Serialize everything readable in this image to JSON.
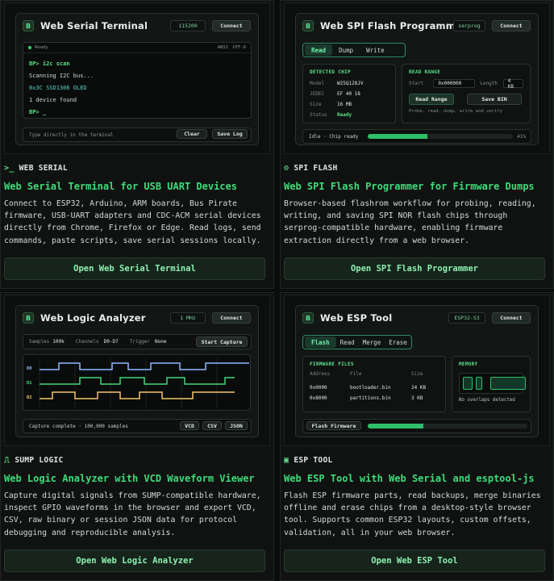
{
  "cards": [
    {
      "window_title": "Web Serial Terminal",
      "baud": "115200",
      "connect": "Connect",
      "status": "Ready",
      "encoding1": "ANSI",
      "encoding2": "UTF-8",
      "lines": [
        {
          "text": "BP> i2c scan",
          "color": "#5ee08a"
        },
        {
          "text": "Scanning I2C bus...",
          "color": "#d3dad6"
        },
        {
          "text": "0x3C SSD1306 OLED",
          "color": "#5fd0c8"
        },
        {
          "text": "1 device found",
          "color": "#d3dad6"
        },
        {
          "text": "BP> _",
          "color": "#5ee08a"
        }
      ],
      "input_placeholder": "Type directly in the terminal",
      "clear": "Clear",
      "save_log": "Save Log",
      "section": "WEB SERIAL",
      "icon": ">_",
      "headline": "Web Serial Terminal for USB UART Devices",
      "description": "Connect to ESP32, Arduino, ARM boards, Bus Pirate firmware, USB-UART adapters and CDC-ACM serial devices directly from Chrome, Firefox or Edge. Read logs, send commands, paste scripts, save serial sessions locally.",
      "cta": "Open Web Serial Terminal"
    },
    {
      "window_title": "Web SPI Flash Programmer",
      "mode": "serprog",
      "connect": "Connect",
      "tabs": [
        "Read",
        "Dump",
        "Write"
      ],
      "detected_title": "DETECTED CHIP",
      "chip": [
        {
          "k": "Model",
          "v": "W25Q128JV"
        },
        {
          "k": "JEDEC",
          "v": "EF 40 18"
        },
        {
          "k": "Size",
          "v": "16 MB"
        },
        {
          "k": "Status",
          "v": "Ready"
        }
      ],
      "range_title": "READ RANGE",
      "start_label": "Start",
      "start_value": "0x000000",
      "length_label": "Length",
      "length_value": "4 KB",
      "read_range": "Read Range",
      "save_bin": "Save BIN",
      "hint": "Probe, read, dump, write and verify",
      "status": "Idle · Chip ready",
      "progress": 0.41,
      "progress_label": "41%",
      "section": "SPI FLASH",
      "headline": "Web SPI Flash Programmer for Firmware Dumps",
      "description": "Browser-based flashrom workflow for probing, reading, writing, and saving SPI NOR flash chips through serprog-compatible hardware, enabling firmware extraction directly from a web browser.",
      "cta": "Open SPI Flash Programmer"
    },
    {
      "window_title": "Web Logic Analyzer",
      "rate": "1 MHz",
      "connect": "Connect",
      "samples_label": "Samples",
      "samples_value": "100k",
      "channels_label": "Channels",
      "channels_value": "D0-D7",
      "trigger_label": "Trigger",
      "trigger_value": "None",
      "start": "Start Capture",
      "channels": [
        {
          "name": "D0",
          "color": "#8fb7ff"
        },
        {
          "name": "D1",
          "color": "#43d77b"
        },
        {
          "name": "D2",
          "color": "#f2c46b"
        }
      ],
      "status": "Capture complete · 100,000 samples",
      "exports": [
        "VCD",
        "CSV",
        "JSON"
      ],
      "section": "SUMP LOGIC",
      "headline": "Web Logic Analyzer with VCD Waveform Viewer",
      "description": "Capture digital signals from SUMP-compatible hardware, inspect GPIO waveforms in the browser and export VCD, CSV, raw binary or session JSON data for protocol debugging and reproducible analysis.",
      "cta": "Open Web Logic Analyzer"
    },
    {
      "window_title": "Web ESP Tool",
      "chip": "ESP32-S3",
      "connect": "Connect",
      "tabs": [
        "Flash",
        "Read",
        "Merge",
        "Erase"
      ],
      "files_title": "FIRMWARE FILES",
      "col_address": "Address",
      "col_file": "File",
      "col_size": "Size",
      "files": [
        {
          "address": "0x0000",
          "file": "bootloader.bin",
          "size": "24 KB"
        },
        {
          "address": "0x8000",
          "file": "partitions.bin",
          "size": "3 KB"
        }
      ],
      "memory_title": "MEMORY",
      "memory_note": "No overlaps detected",
      "flash_button": "Flash Firmware",
      "progress": 0.35,
      "section": "ESP TOOL",
      "headline": "Web ESP Tool with Web Serial and esptool-js",
      "description": "Flash ESP firmware parts, read backups, merge binaries offline and erase chips from a desktop-style browser tool. Supports common ESP32 layouts, custom offsets, validation, all in your web browser.",
      "cta": "Open Web ESP Tool"
    }
  ]
}
